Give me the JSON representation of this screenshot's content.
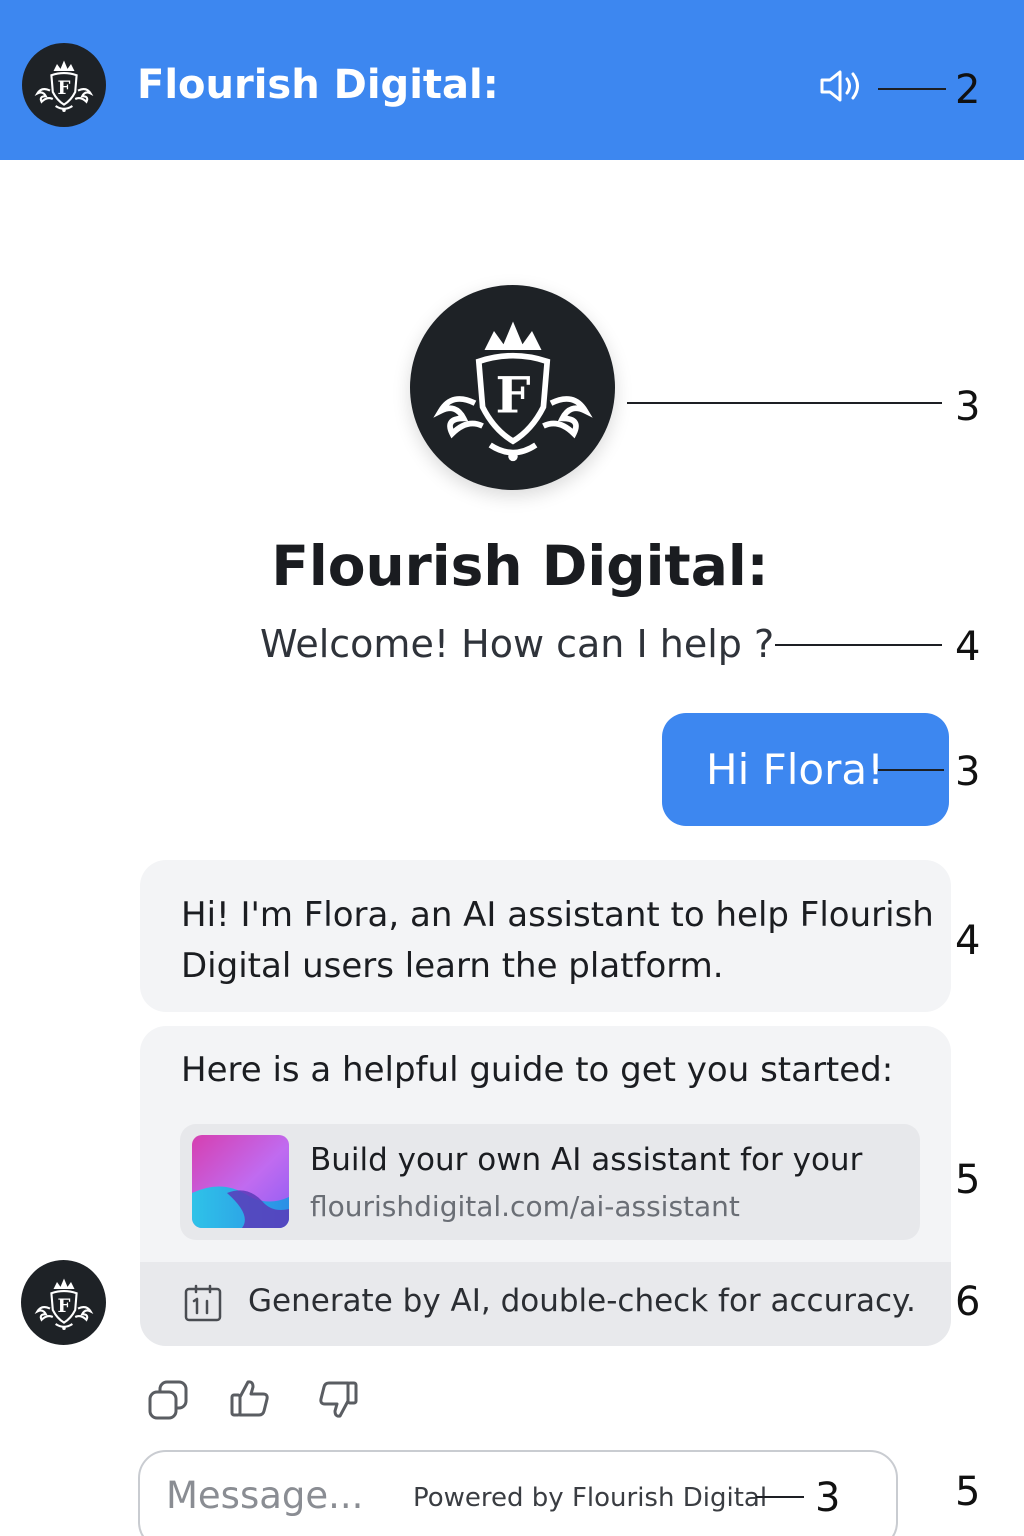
{
  "header": {
    "title": "Flourish Digital:",
    "logo_icon": "crest-logo-icon",
    "speaker_icon": "speaker-icon",
    "callout": "2"
  },
  "hero": {
    "title": "Flourish Digital:",
    "welcome": "Welcome! How can I help ?",
    "logo_callout": "3",
    "welcome_callout": "4"
  },
  "conversation": {
    "user_message": "Hi Flora!",
    "user_callout": "3",
    "bot_message": "Hi! I'm Flora, an AI assistant to help Flourish Digital users learn the platform.",
    "bot_callout": "4",
    "guide_intro": "Here is a helpful guide to get you started:",
    "link": {
      "title": "Build your own AI assistant for your",
      "url": "flourishdigital.com/ai-assistant"
    },
    "link_callout": "5",
    "disclaimer": "Generate by AI, double-check for accuracy.",
    "disclaimer_callout": "6"
  },
  "actions": {
    "copy_icon": "copy-icon",
    "like_icon": "thumbs-up-icon",
    "dislike_icon": "thumbs-down-icon"
  },
  "composer": {
    "placeholder": "Message...",
    "powered_by": "Powered by Flourish Digital",
    "powered_callout": "3",
    "outer_callout": "5"
  },
  "colors": {
    "brand_blue": "#3d87f0",
    "logo_dark": "#1e2226",
    "bubble_gray": "#f3f4f6"
  }
}
